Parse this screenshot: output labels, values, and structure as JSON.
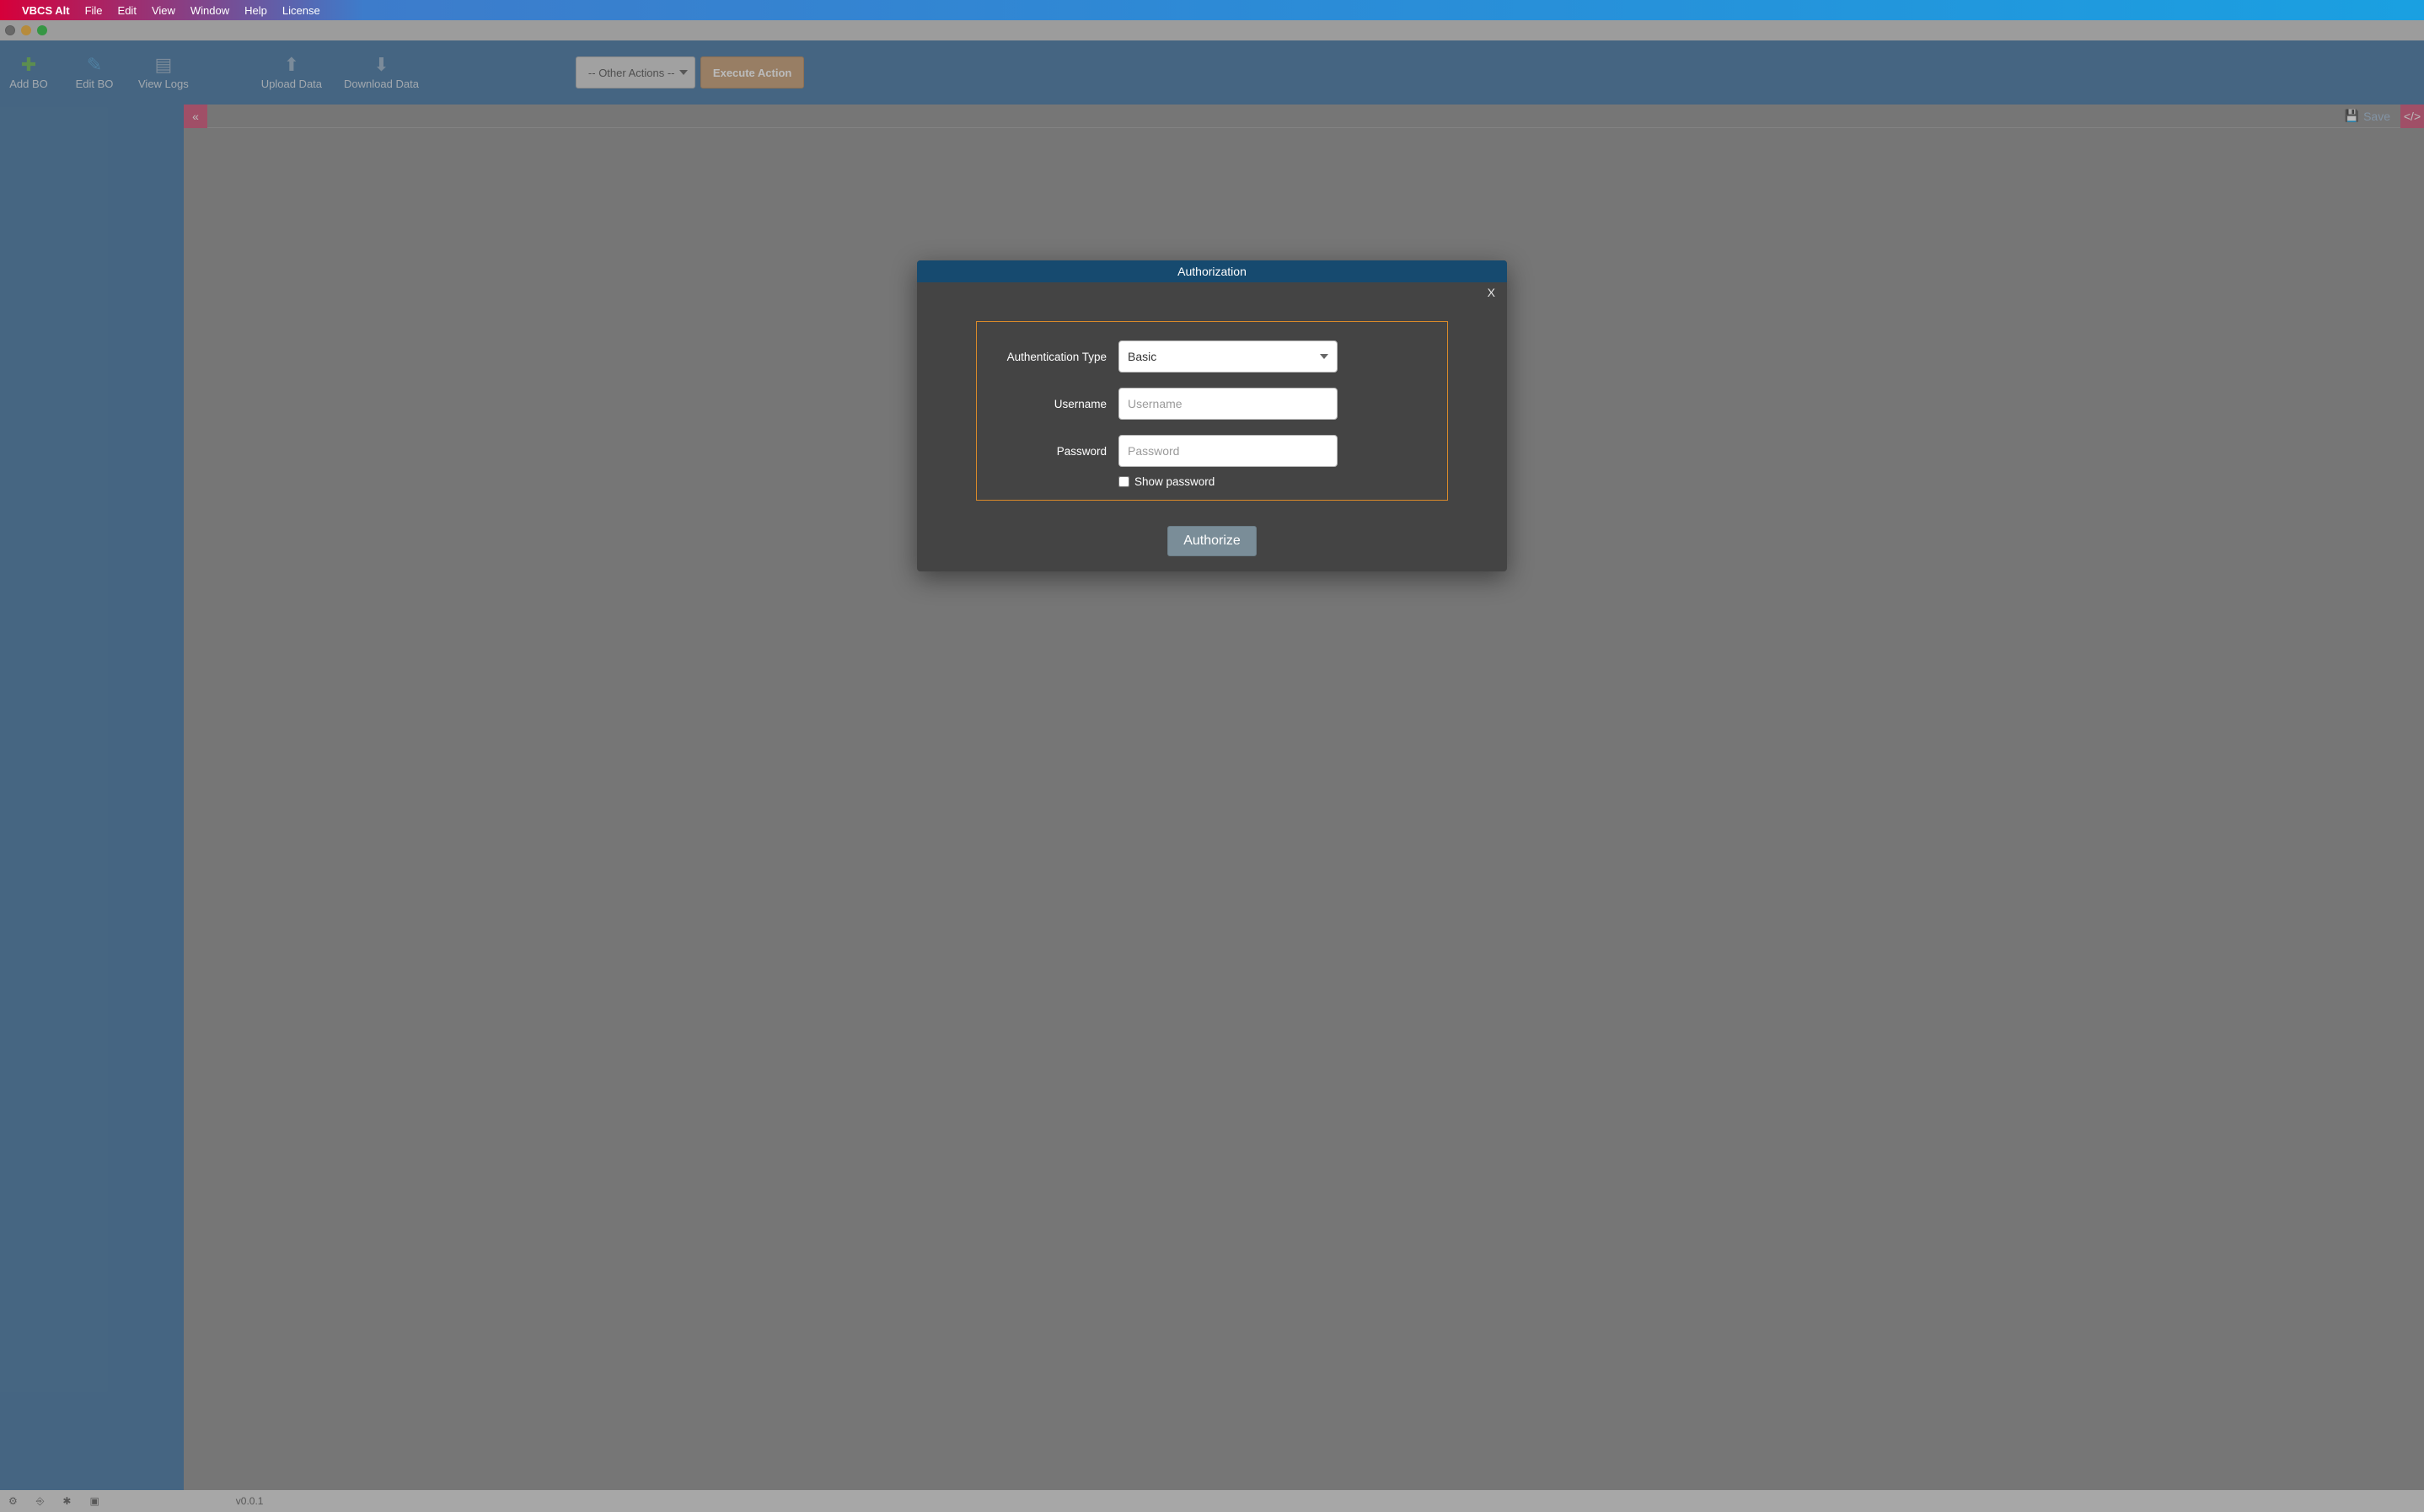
{
  "menubar": {
    "app_name": "VBCS Alt",
    "items": [
      "File",
      "Edit",
      "View",
      "Window",
      "Help",
      "License"
    ]
  },
  "toolbar": {
    "add_bo": "Add BO",
    "edit_bo": "Edit BO",
    "view_logs": "View Logs",
    "upload_data": "Upload Data",
    "download_data": "Download Data",
    "other_actions_selected": "-- Other Actions --",
    "execute_action": "Execute Action"
  },
  "ribbon": {
    "save": "Save"
  },
  "modal": {
    "title": "Authorization",
    "close": "X",
    "auth_type_label": "Authentication Type",
    "auth_type_value": "Basic",
    "username_label": "Username",
    "username_placeholder": "Username",
    "password_label": "Password",
    "password_placeholder": "Password",
    "show_password": "Show password",
    "authorize": "Authorize"
  },
  "status": {
    "version": "v0.0.1"
  }
}
